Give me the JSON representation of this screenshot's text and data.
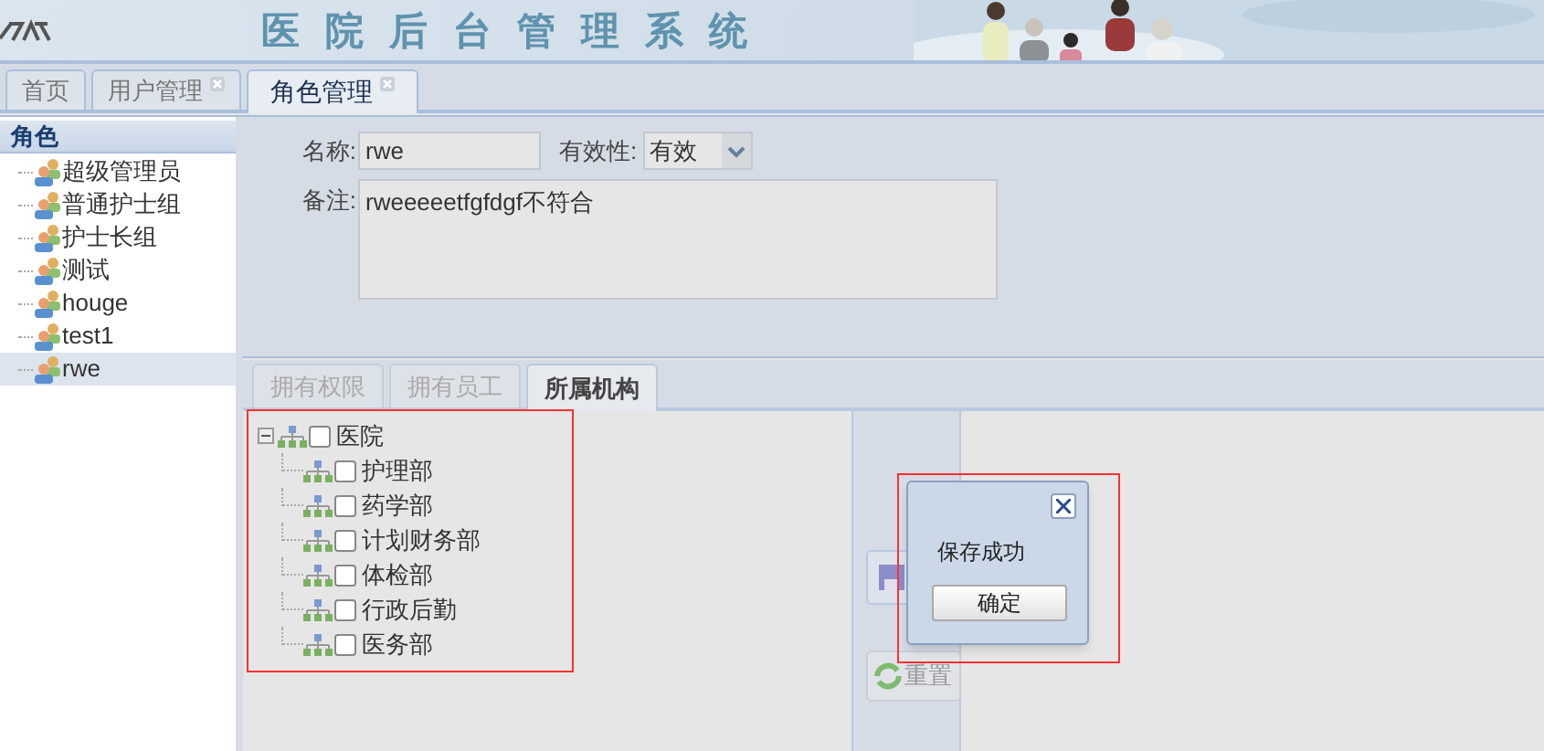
{
  "header": {
    "title": "医院后台管理系统"
  },
  "tabs": [
    {
      "label": "首页",
      "closable": false,
      "selected": false
    },
    {
      "label": "用户管理",
      "closable": true,
      "selected": false
    },
    {
      "label": "角色管理",
      "closable": true,
      "selected": true
    }
  ],
  "sidebar": {
    "title": "角色",
    "items": [
      {
        "label": "超级管理员",
        "selected": false
      },
      {
        "label": "普通护士组",
        "selected": false
      },
      {
        "label": "护士长组",
        "selected": false
      },
      {
        "label": "测试",
        "selected": false
      },
      {
        "label": "houge",
        "selected": false
      },
      {
        "label": "test1",
        "selected": false
      },
      {
        "label": "rwe",
        "selected": true
      }
    ]
  },
  "form": {
    "name_label": "名称:",
    "name_value": "rwe",
    "validity_label": "有效性:",
    "validity_value": "有效",
    "remark_label": "备注:",
    "remark_value": "rweeeeetfgfdgf不符合"
  },
  "subtabs": [
    {
      "label": "拥有权限",
      "selected": false
    },
    {
      "label": "拥有员工",
      "selected": false
    },
    {
      "label": "所属机构",
      "selected": true
    }
  ],
  "tree": [
    {
      "label": "医院",
      "checked": false,
      "expanded": true,
      "children": [
        {
          "label": "护理部",
          "checked": false
        },
        {
          "label": "药学部",
          "checked": false
        },
        {
          "label": "计划财务部",
          "checked": false
        },
        {
          "label": "体检部",
          "checked": false
        },
        {
          "label": "行政后勤",
          "checked": false
        },
        {
          "label": "医务部",
          "checked": false
        }
      ]
    }
  ],
  "reset_button": {
    "label": "重置"
  },
  "dialog": {
    "message": "保存成功",
    "ok_button": "确定"
  }
}
